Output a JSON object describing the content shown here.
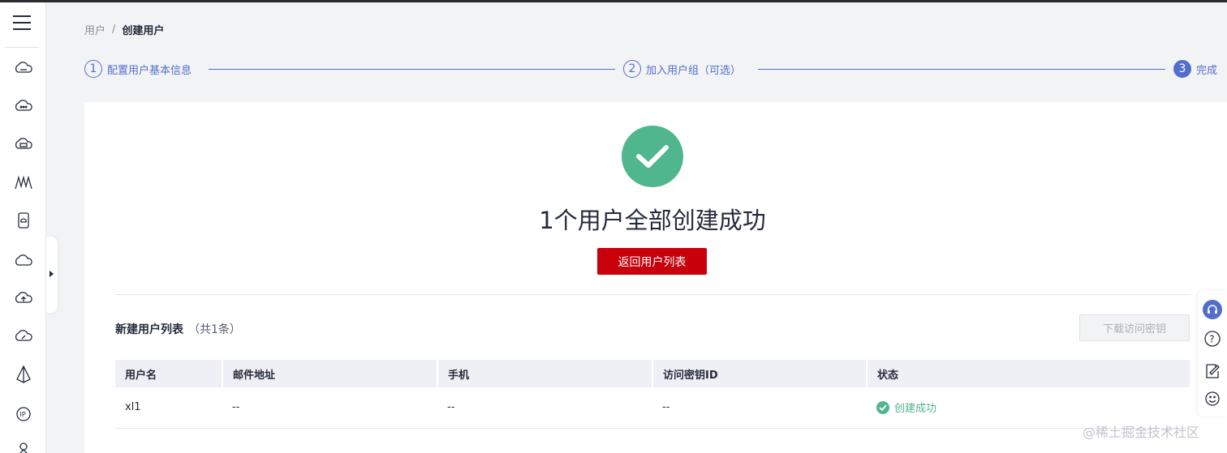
{
  "breadcrumb": {
    "parent": "用户",
    "separator": "/",
    "current": "创建用户"
  },
  "steps": [
    {
      "number": "1",
      "label": "配置用户基本信息"
    },
    {
      "number": "2",
      "label": "加入用户组（可选）"
    },
    {
      "number": "3",
      "label": "完成"
    }
  ],
  "result": {
    "title": "1个用户全部创建成功",
    "return_button": "返回用户列表"
  },
  "list": {
    "title": "新建用户列表",
    "count": "（共1条）",
    "download_button": "下载访问密钥",
    "columns": [
      "用户名",
      "邮件地址",
      "手机",
      "访问密钥ID",
      "状态"
    ],
    "rows": [
      {
        "username": "xl1",
        "email": "--",
        "phone": "--",
        "access_key": "--",
        "status": "创建成功"
      }
    ]
  },
  "watermark": "@稀土掘金技术社区",
  "sidebar_icons": [
    "cloud-ellipsis-icon",
    "cloud-dots-icon",
    "cloud-server-icon",
    "peaks-icon",
    "device-cloud-icon",
    "cloud-icon",
    "cloud-upload-icon",
    "cloud-gauge-icon",
    "cone-icon",
    "ip-icon",
    "network-icon"
  ],
  "colors": {
    "accent": "#526ecc",
    "brand_red": "#c7000b",
    "success": "#50b68e"
  }
}
